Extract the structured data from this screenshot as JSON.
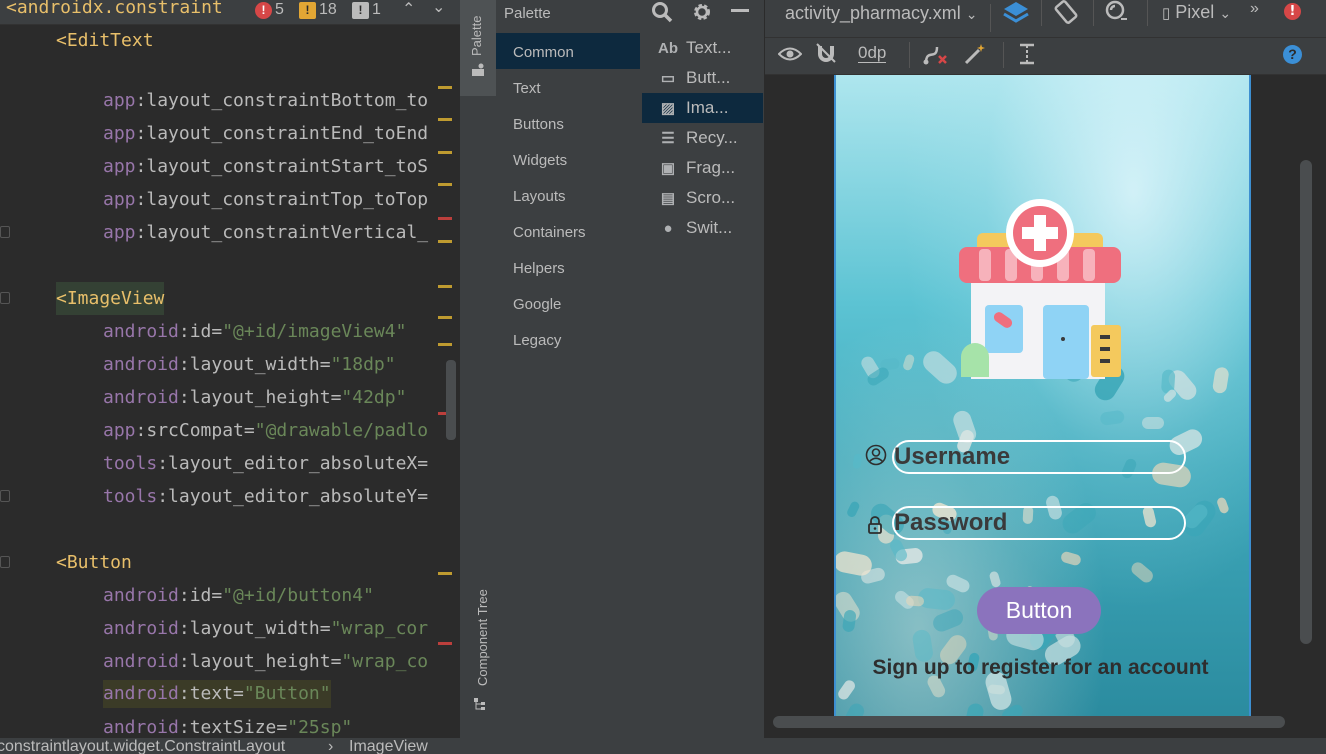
{
  "editor": {
    "top_tag": "<androidx.constraint",
    "inspections": {
      "errors": "5",
      "warnings": "18",
      "weak_warnings": "1"
    },
    "lines": [
      {
        "parts": [
          [
            "tag",
            "<EditText"
          ]
        ]
      },
      {
        "parts": []
      },
      {
        "parts": [
          [
            "ns",
            "app"
          ],
          [
            "attr",
            ":layout_constraintBottom_to"
          ]
        ]
      },
      {
        "parts": [
          [
            "ns",
            "app"
          ],
          [
            "attr",
            ":layout_constraintEnd_toEnd"
          ]
        ]
      },
      {
        "parts": [
          [
            "ns",
            "app"
          ],
          [
            "attr",
            ":layout_constraintStart_toS"
          ]
        ]
      },
      {
        "parts": [
          [
            "ns",
            "app"
          ],
          [
            "attr",
            ":layout_constraintTop_toTop"
          ]
        ]
      },
      {
        "parts": [
          [
            "ns",
            "app"
          ],
          [
            "attr",
            ":layout_constraintVertical_"
          ]
        ]
      },
      {
        "parts": []
      },
      {
        "parts": [
          [
            "tag",
            "<ImageView"
          ]
        ]
      },
      {
        "parts": [
          [
            "ns",
            "android"
          ],
          [
            "attr",
            ":id="
          ],
          [
            "val",
            "\"@+id/imageView4\""
          ]
        ]
      },
      {
        "parts": [
          [
            "ns",
            "android"
          ],
          [
            "attr",
            ":layout_width="
          ],
          [
            "val",
            "\"18dp\""
          ]
        ]
      },
      {
        "parts": [
          [
            "ns",
            "android"
          ],
          [
            "attr",
            ":layout_height="
          ],
          [
            "val",
            "\"42dp\""
          ]
        ]
      },
      {
        "parts": [
          [
            "ns",
            "app"
          ],
          [
            "attr",
            ":srcCompat="
          ],
          [
            "val",
            "\"@drawable/padlo"
          ]
        ]
      },
      {
        "parts": [
          [
            "ns",
            "tools"
          ],
          [
            "attr",
            ":layout_editor_absoluteX="
          ]
        ]
      },
      {
        "parts": [
          [
            "ns",
            "tools"
          ],
          [
            "attr",
            ":layout_editor_absoluteY="
          ]
        ]
      },
      {
        "parts": []
      },
      {
        "parts": [
          [
            "tag",
            "<Button"
          ]
        ]
      },
      {
        "parts": [
          [
            "ns",
            "android"
          ],
          [
            "attr",
            ":id="
          ],
          [
            "val",
            "\"@+id/button4\""
          ]
        ]
      },
      {
        "parts": [
          [
            "ns",
            "android"
          ],
          [
            "attr",
            ":layout_width="
          ],
          [
            "val",
            "\"wrap_cor"
          ]
        ]
      },
      {
        "parts": [
          [
            "ns",
            "android"
          ],
          [
            "attr",
            ":layout_height="
          ],
          [
            "val",
            "\"wrap_co"
          ]
        ]
      },
      {
        "parts": [
          [
            "ns",
            "android"
          ],
          [
            "attr",
            ":text="
          ],
          [
            "val",
            "\"Button\""
          ]
        ]
      },
      {
        "parts": [
          [
            "ns",
            "android"
          ],
          [
            "attr",
            ":textSize="
          ],
          [
            "val",
            "\"25sp\""
          ]
        ]
      }
    ]
  },
  "palette": {
    "tab_label": "Palette",
    "component_tree_label": "Component Tree",
    "title": "Palette",
    "categories": [
      "Common",
      "Text",
      "Buttons",
      "Widgets",
      "Layouts",
      "Containers",
      "Helpers",
      "Google",
      "Legacy"
    ],
    "selected_category": "Common",
    "widgets": [
      {
        "icon": "text-icon",
        "glyph": "Ab",
        "label": "Text..."
      },
      {
        "icon": "button-icon",
        "glyph": "▭",
        "label": "Butt..."
      },
      {
        "icon": "image-icon",
        "glyph": "▨",
        "label": "Ima..."
      },
      {
        "icon": "recycler-icon",
        "glyph": "☰",
        "label": "Recy..."
      },
      {
        "icon": "fragment-icon",
        "glyph": "▣",
        "label": "Frag..."
      },
      {
        "icon": "scroll-icon",
        "glyph": "▤",
        "label": "Scro..."
      },
      {
        "icon": "switch-icon",
        "glyph": "●",
        "label": "Swit..."
      }
    ],
    "selected_widget": "Ima..."
  },
  "design": {
    "file_name": "activity_pharmacy.xml",
    "device": "Pixel",
    "margin": "0dp",
    "help": "?"
  },
  "preview": {
    "username_placeholder": "Username",
    "password_placeholder": "Password",
    "button_label": "Button",
    "signup_text": "Sign up to register for an account"
  },
  "status": {
    "breadcrumb_1": "constraintlayout.widget.ConstraintLayout",
    "separator": "›",
    "breadcrumb_2": "ImageView"
  },
  "colors": {
    "tag": "#e8bf6a",
    "namespace": "#9876aa",
    "value": "#6a8759",
    "button": "#8b73bd",
    "selection": "#0d293e"
  }
}
